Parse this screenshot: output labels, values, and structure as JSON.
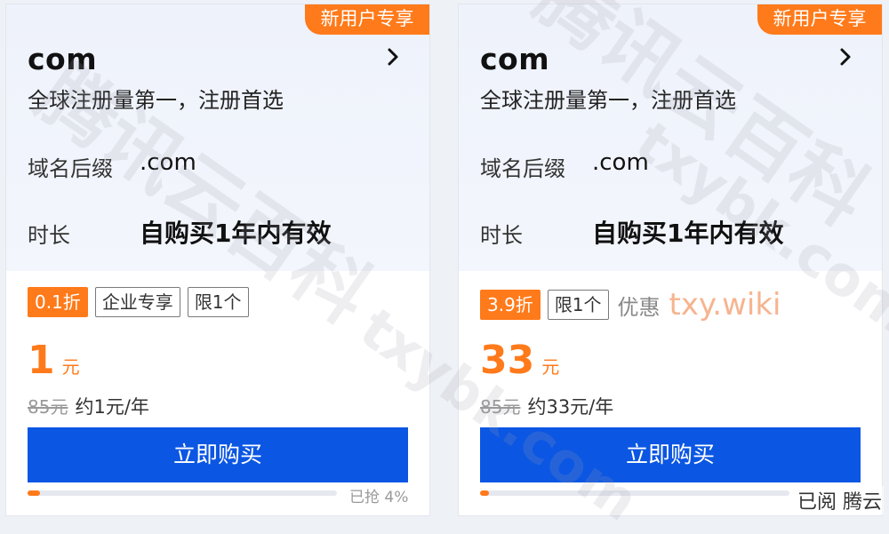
{
  "cards": [
    {
      "badge": "新用户专享",
      "title": "com",
      "description": "全球注册量第一，注册首选",
      "suffix_label": "域名后缀",
      "suffix_value": ".com",
      "duration_label": "时长",
      "duration_value": "自购买1年内有效",
      "tags": [
        "0.1折",
        "企业专享",
        "限1个"
      ],
      "price": "1",
      "price_unit": "元",
      "original_price": "85元",
      "per_year": "约1元/年",
      "buy_label": "立即购买",
      "progress_percent": 4,
      "sold_text": "已抢 4%"
    },
    {
      "badge": "新用户专享",
      "title": "com",
      "description": "全球注册量第一，注册首选",
      "suffix_label": "域名后缀",
      "suffix_value": ".com",
      "duration_label": "时长",
      "duration_value": "自购买1年内有效",
      "tags": [
        "3.9折",
        "限1个"
      ],
      "promo_label": "优惠",
      "promo_text": "txy.wiki",
      "price": "33",
      "price_unit": "元",
      "original_price": "85元",
      "per_year": "约33元/年",
      "buy_label": "立即购买",
      "progress_percent": 3
    }
  ],
  "watermarks": {
    "cn": "腾讯云百科",
    "en": "txybk.com",
    "footer": "已阅 腾云"
  },
  "colors": {
    "accent_orange": "#ff7a1a",
    "buy_blue": "#0b56e3"
  },
  "icons": {
    "chevron": "chevron-right-icon"
  }
}
